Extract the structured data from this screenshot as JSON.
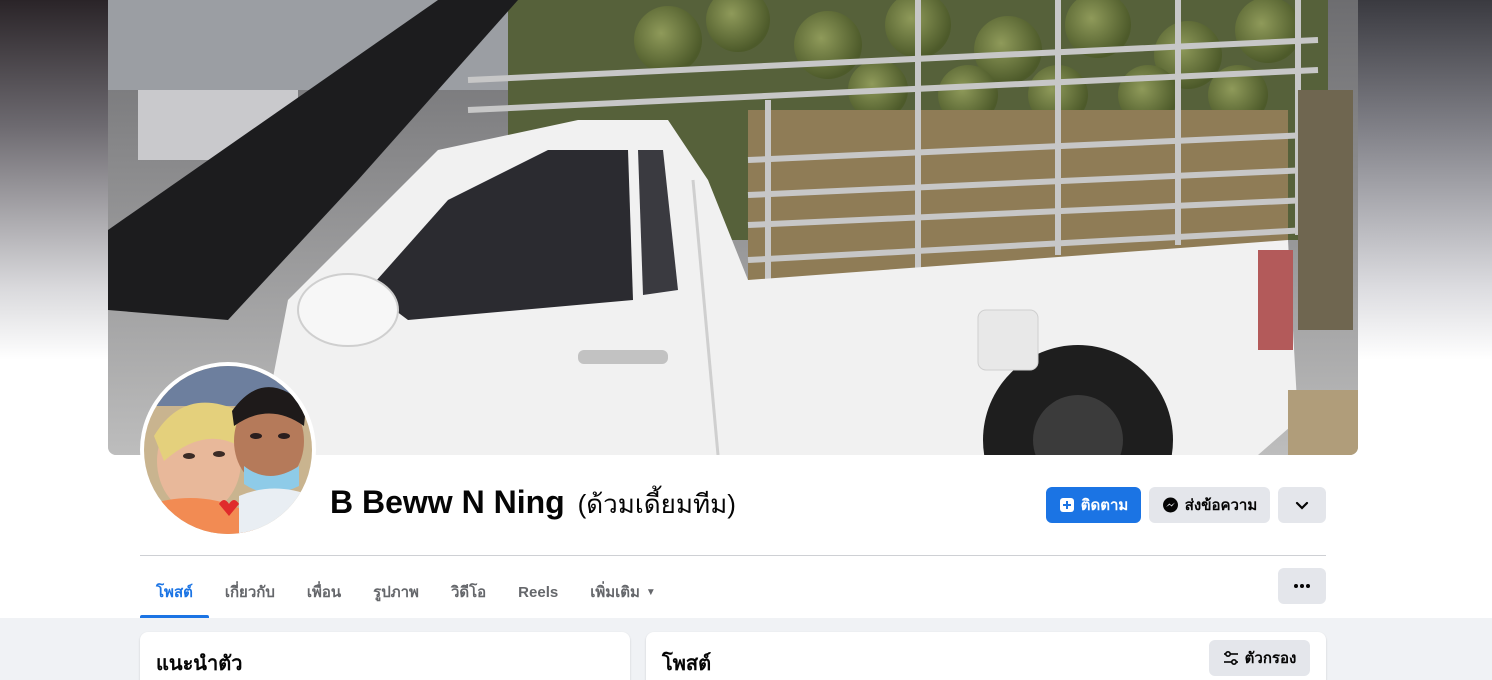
{
  "profile": {
    "name": "B Beww N Ning",
    "alt_name": "(ด้วมเดี้ยมทีม)"
  },
  "actions": {
    "follow_label": "ติดตาม",
    "message_label": "ส่งข้อความ",
    "more_icon": "chevron-down-icon",
    "menu_icon": "more-dots-icon"
  },
  "tabs": [
    {
      "label": "โพสต์",
      "active": true
    },
    {
      "label": "เกี่ยวกับ",
      "active": false
    },
    {
      "label": "เพื่อน",
      "active": false
    },
    {
      "label": "รูปภาพ",
      "active": false
    },
    {
      "label": "วิดีโอ",
      "active": false
    },
    {
      "label": "Reels",
      "active": false
    },
    {
      "label": "เพิ่มเติม",
      "active": false
    }
  ],
  "intro": {
    "title": "แนะนำตัว"
  },
  "posts": {
    "title": "โพสต์",
    "filter_label": "ตัวกรอง"
  },
  "colors": {
    "accent": "#1b74e4",
    "secondary_button": "#e4e6eb",
    "background": "#f0f2f5"
  }
}
